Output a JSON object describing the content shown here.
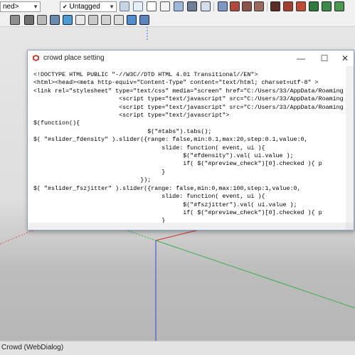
{
  "toolbar": {
    "style_combo": "ned>",
    "tag_combo": "Untagged",
    "check_glyph": "✔"
  },
  "dialog": {
    "title": "crowd place setting",
    "minimize_glyph": "—",
    "maximize_glyph": "☐",
    "close_glyph": "✕",
    "code_lines": [
      "<!DOCTYPE HTML PUBLIC \"-//W3C//DTD HTML 4.01 Transitional//EN\">",
      "<html><head><meta http-equiv=\"Content-Type\" content=\"text/html; charset=utf-8\" >",
      "<link rel=\"stylesheet\" type=\"text/css\" media=\"screen\" href=\"C:/Users/33/AppData/Roaming",
      "                        <script type=\"text/javascript\" src=\"C:/Users/33/AppData/Roaming",
      "                        <script type=\"text/javascript\" src=\"C:/Users/33/AppData/Roaming",
      "                        <script type=\"text/javascript\">",
      "$(function(){",
      "                                $(\"#tabs\").tabs();",
      "$( \"#slider_fdensity\" ).slider({range: false,min:0.1,max:20,step:0.1,value:0,",
      "                                    slide: function( event, ui ){",
      "                                          $(\"#fdensity\").val( ui.value );",
      "                                          if( $(\"#preview_check\")[0].checked ){ p",
      "                                    }",
      "                              });",
      "$( \"#slider_fszjitter\" ).slider({range: false,min:0,max:100,step:1,value:0,",
      "                                    slide: function( event, ui ){",
      "                                          $(\"#fszjitter\").val( ui.value );",
      "                                          if( $(\"#preview_check\")[0].checked ){ p",
      "                                    }",
      "                              });",
      "});"
    ]
  },
  "status_bar": {
    "text": "Crowd (WebDialog)"
  }
}
